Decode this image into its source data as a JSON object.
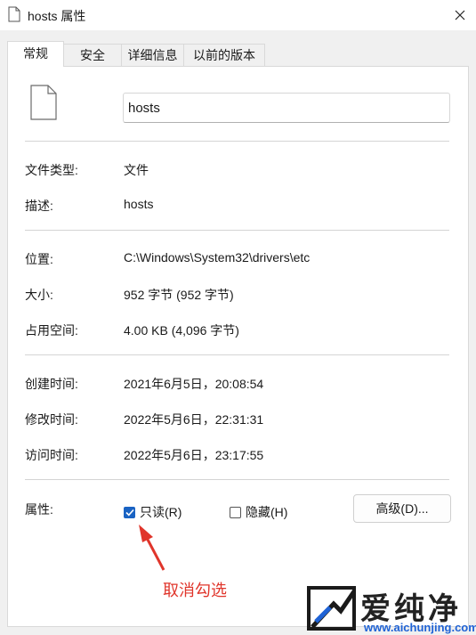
{
  "window": {
    "title": "hosts 属性"
  },
  "tabs": [
    {
      "label": "常规",
      "active": true
    },
    {
      "label": "安全",
      "active": false
    },
    {
      "label": "详细信息",
      "active": false
    },
    {
      "label": "以前的版本",
      "active": false
    }
  ],
  "general": {
    "file_name": "hosts",
    "rows": {
      "type": {
        "label": "文件类型:",
        "value": "文件"
      },
      "description": {
        "label": "描述:",
        "value": "hosts"
      },
      "location": {
        "label": "位置:",
        "value": "C:\\Windows\\System32\\drivers\\etc"
      },
      "size": {
        "label": "大小:",
        "value": "952 字节 (952 字节)"
      },
      "size_on_disk": {
        "label": "占用空间:",
        "value": "4.00 KB (4,096 字节)"
      },
      "created": {
        "label": "创建时间:",
        "value": "2021年6月5日，20:08:54"
      },
      "modified": {
        "label": "修改时间:",
        "value": "2022年5月6日，22:31:31"
      },
      "accessed": {
        "label": "访问时间:",
        "value": "2022年5月6日，23:17:55"
      }
    },
    "attributes": {
      "label": "属性:",
      "readonly": {
        "label": "只读(R)",
        "checked": true
      },
      "hidden": {
        "label": "隐藏(H)",
        "checked": false
      },
      "advanced_button": "高级(D)..."
    }
  },
  "annotation": {
    "text": "取消勾选",
    "color": "#e0352b"
  },
  "watermark": {
    "brand": "爱纯净",
    "url": "www.aichunjing.com"
  },
  "colors": {
    "checkbox_accent": "#1a63c3",
    "watermark_url": "#1f63d6"
  },
  "icons": {
    "title_icon": "file-icon",
    "close": "close-icon",
    "file_big": "file-icon",
    "check": "check-icon"
  }
}
